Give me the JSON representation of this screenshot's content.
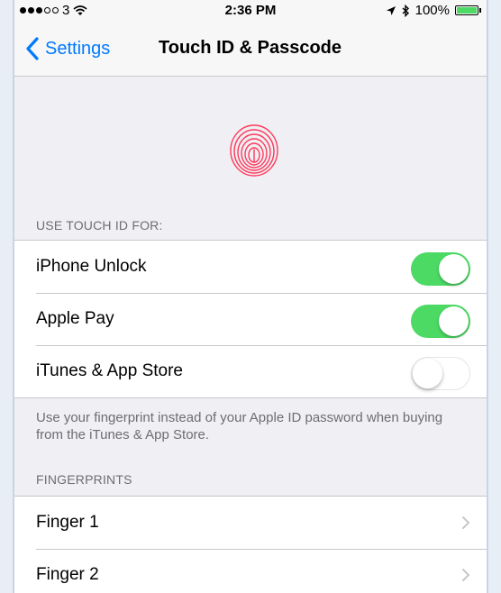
{
  "status_bar": {
    "carrier": "3",
    "time": "2:36 PM",
    "battery": "100%",
    "signal_dots_filled": 3,
    "signal_dots_total": 5
  },
  "nav": {
    "back_label": "Settings",
    "title": "Touch ID & Passcode"
  },
  "touch_id_section": {
    "header": "USE TOUCH ID FOR:",
    "rows": [
      {
        "label": "iPhone Unlock",
        "enabled": true
      },
      {
        "label": "Apple Pay",
        "enabled": true
      },
      {
        "label": "iTunes & App Store",
        "enabled": false
      }
    ],
    "footer": "Use your fingerprint instead of your Apple ID password when buying from the iTunes & App Store."
  },
  "fingerprints_section": {
    "header": "FINGERPRINTS",
    "rows": [
      {
        "label": "Finger 1"
      },
      {
        "label": "Finger 2"
      }
    ]
  },
  "colors": {
    "accent": "#007aff",
    "switch_on": "#4cd964",
    "fingerprint": "#ff3b5c"
  },
  "icons": {
    "back": "chevron-left-icon",
    "fingerprint": "fingerprint-icon",
    "row_disclosure": "chevron-right-icon",
    "wifi": "wifi-icon",
    "location": "location-arrow-icon",
    "bluetooth": "bluetooth-icon",
    "battery": "battery-icon"
  }
}
